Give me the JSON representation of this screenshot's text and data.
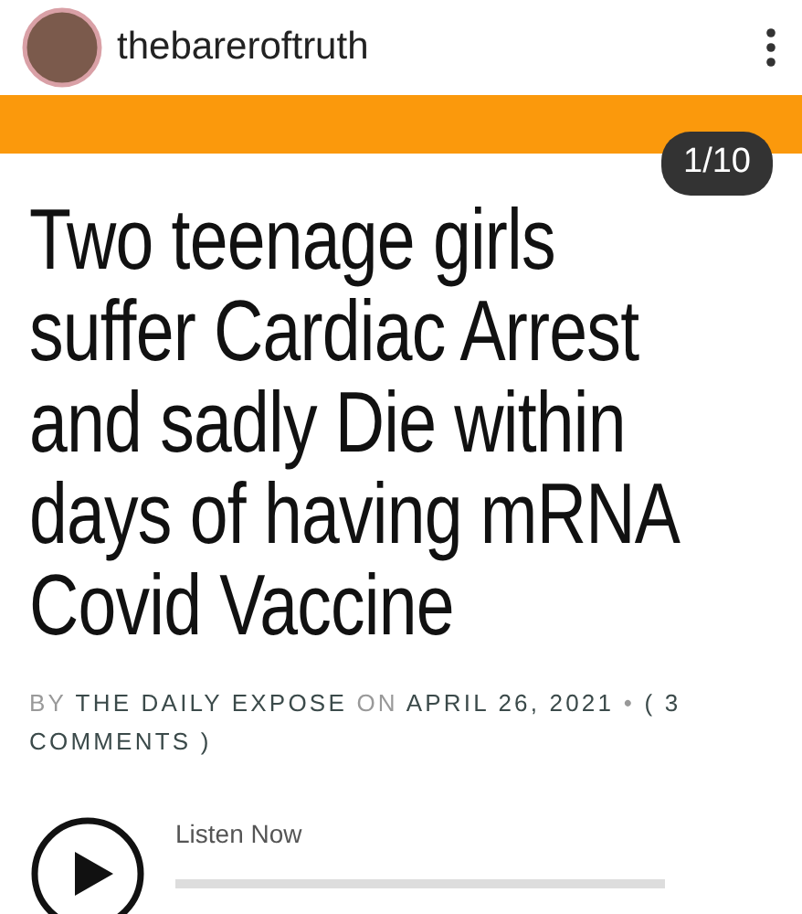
{
  "post_header": {
    "username": "thebareroftruth"
  },
  "slide_counter": "1/10",
  "article": {
    "headline": "Two teenage girls suffer Cardiac Arrest and sadly Die within days of having mRNA Covid Vaccine",
    "meta": [
      {
        "kind": "label",
        "text": "BY"
      },
      {
        "kind": "link",
        "text": "THE DAILY EXPOSE"
      },
      {
        "kind": "label",
        "text": "ON"
      },
      {
        "kind": "link",
        "text": "APRIL 26, 2021"
      },
      {
        "kind": "label",
        "text": "•"
      },
      {
        "kind": "wrap",
        "text": "( 3 COMMENTS )"
      }
    ]
  },
  "audio_player": {
    "label": "Listen Now"
  }
}
